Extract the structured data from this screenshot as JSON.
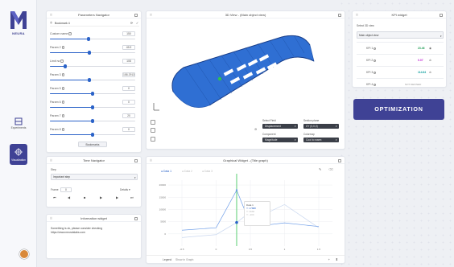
{
  "app": {
    "logo_text": "NEURA",
    "rail": [
      {
        "label": "Experiments",
        "icon": "flask-icon"
      },
      {
        "label": "Visualization",
        "icon": "visualization-icon"
      }
    ]
  },
  "param_nav": {
    "title": "Parameters Navigator",
    "bookmark_label": "Bookmark 4",
    "params": [
      {
        "label": "Custom name",
        "value": "150",
        "pct": 0.45
      },
      {
        "label": "Param 2",
        "value": "45.9",
        "pct": 0.46
      },
      {
        "label": "Limit rw",
        "value": "108",
        "pct": 0.18
      },
      {
        "label": "Param 3",
        "value": "158.2913",
        "pct": 0.46
      },
      {
        "label": "Param 5",
        "value": "0",
        "pct": 0.5
      },
      {
        "label": "Param 6",
        "value": "0",
        "pct": 0.5
      },
      {
        "label": "Param 7",
        "value": "20",
        "pct": 0.5
      },
      {
        "label": "Param 8",
        "value": "0",
        "pct": 0.5
      }
    ],
    "bookmarks_button": "Bookmarks"
  },
  "view3d": {
    "title": "3D View - (Main object view)",
    "select_field_label": "Select Field",
    "select_field_value": "Displacement",
    "section_plane_label": "Section plane",
    "section_plane_value": "XY (0,0,0)",
    "component_label": "Component",
    "component_value": "Magnitude",
    "colormap_label": "Colormap",
    "colormap_value": "Cool to warm"
  },
  "kpi": {
    "title": "KPI widget",
    "select_label": "Select 3D view",
    "select_value": "Main object view",
    "rows": [
      {
        "name": "KPI 1",
        "value": "23.46",
        "color": "#1f9d55",
        "icon": "eye-icon"
      },
      {
        "name": "KPI 2",
        "value": "0.07",
        "color": "#c026d3",
        "icon": "link-icon"
      },
      {
        "name": "KPI 3",
        "value": "114.64",
        "color": "#0e9f9f",
        "icon": "link-icon"
      },
      {
        "name": "KPI 4",
        "value": "NOT DEFINED",
        "color": "#999999",
        "icon": "link-icon"
      }
    ]
  },
  "optimization_button": "OPTIMIZATION",
  "time_nav": {
    "title": "Time Navigator",
    "step_label": "Step",
    "step_value": "Important step",
    "frame_label": "Frame",
    "frame_value": "0",
    "details_label": "Details"
  },
  "info": {
    "title": "Information widget",
    "line1": "Something is ok, please consider checking",
    "line2": "https://www.neuraislabs.com"
  },
  "graph": {
    "title": "Graphical Widget - (Title graph)",
    "legend": [
      "Data 1",
      "Data 2",
      "Data 3"
    ],
    "footer_label": "Legend",
    "footer_value": "Show in Graph",
    "tooltip": {
      "line1": "Data 1",
      "line2": "Y: 17888",
      "line3": "Y: 4660",
      "line4": "Y: -400"
    }
  },
  "chart_data": {
    "type": "line",
    "title": "Graphical Widget - (Title graph)",
    "x": [
      -0.5,
      0.0,
      0.3,
      0.5,
      0.7,
      1.0,
      1.5
    ],
    "yticks": [
      "20000",
      "15000",
      "10000",
      "5000",
      "0"
    ],
    "xticks": [
      "-0.5",
      "0",
      "0.5",
      "1",
      "1.5"
    ],
    "ylim": [
      -5000,
      22000
    ],
    "series": [
      {
        "name": "Data 1",
        "values": [
          1500,
          2500,
          17888,
          4000,
          3500,
          4500,
          3000
        ],
        "color": "#6f9ee8"
      },
      {
        "name": "Data 3",
        "values": [
          -1500,
          -300,
          4660,
          9000,
          8000,
          12000,
          2500
        ],
        "color": "#c9d7ef"
      }
    ]
  },
  "colors": {
    "accent": "#3f4295",
    "blue": "#2a62c8"
  }
}
